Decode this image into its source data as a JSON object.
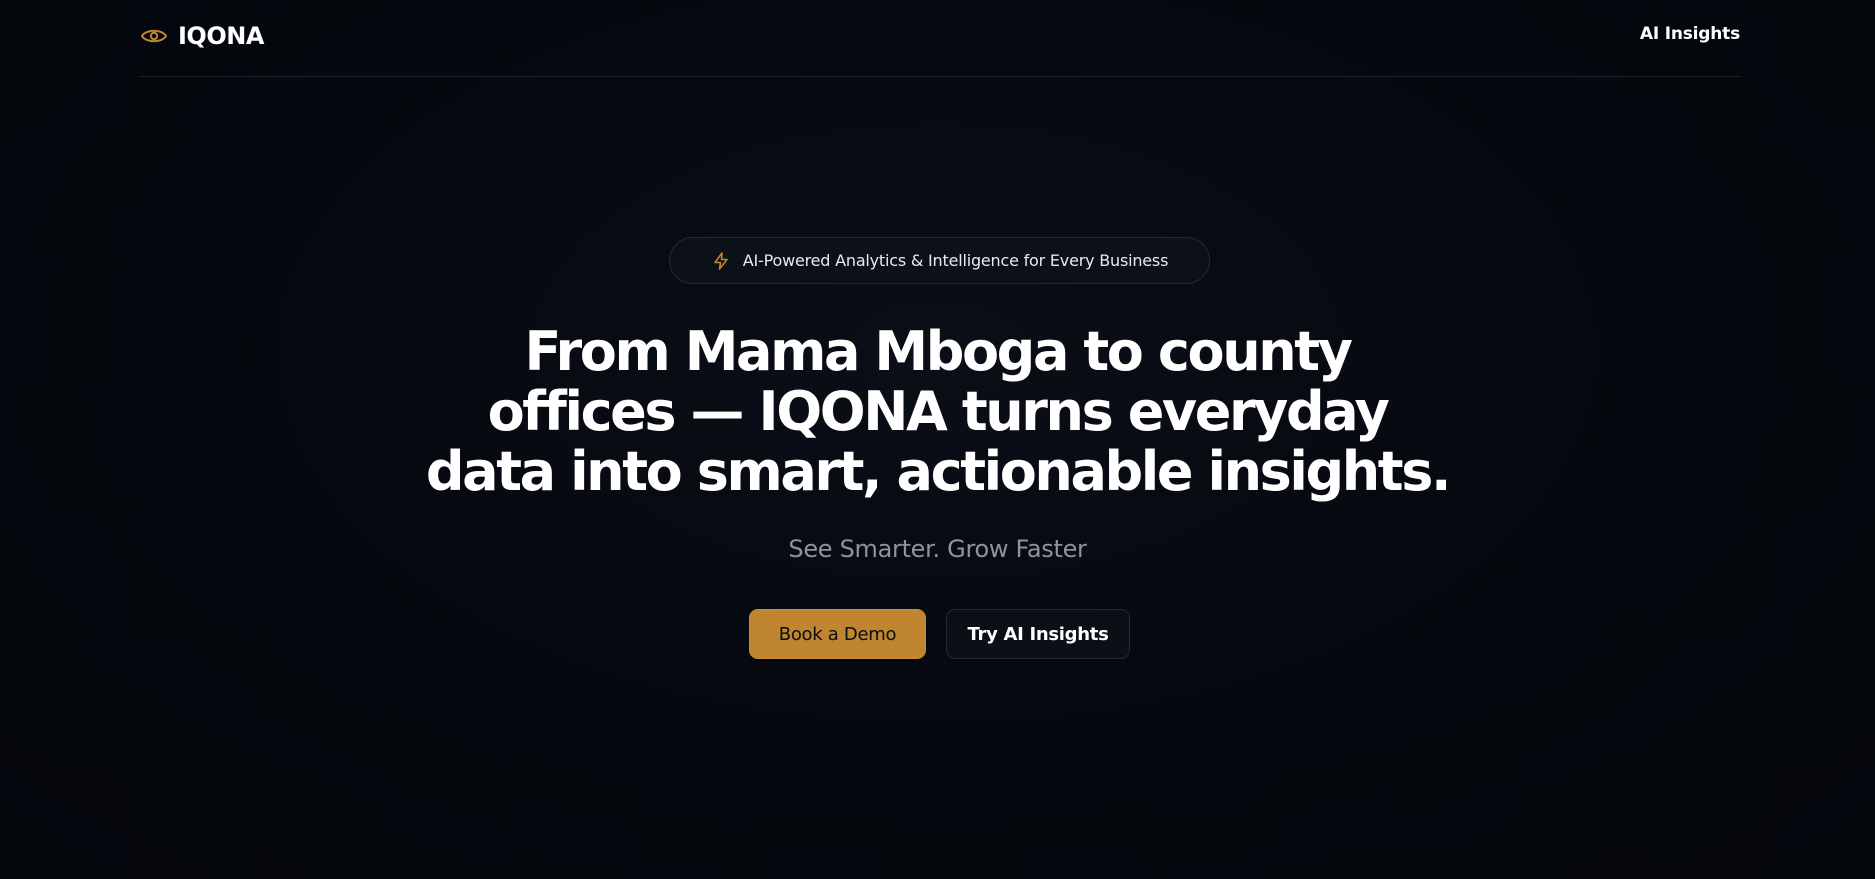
{
  "header": {
    "brand": "IQONA",
    "brand_icon": "eye-icon",
    "nav_link": "AI Insights"
  },
  "hero": {
    "badge_icon": "lightning-icon",
    "badge_text": "AI-Powered Analytics & Intelligence for Every Business",
    "headline_lines": [
      "From Mama Mboga to county",
      "offices — IQONA turns everyday",
      "data into smart, actionable insights."
    ],
    "subtitle": "See Smarter. Grow Faster",
    "primary_button": "Book a Demo",
    "secondary_button": "Try AI Insights"
  },
  "colors": {
    "accent": "#c0852f",
    "background": "#05080e",
    "text": "#ffffff",
    "muted": "#8f939a"
  }
}
